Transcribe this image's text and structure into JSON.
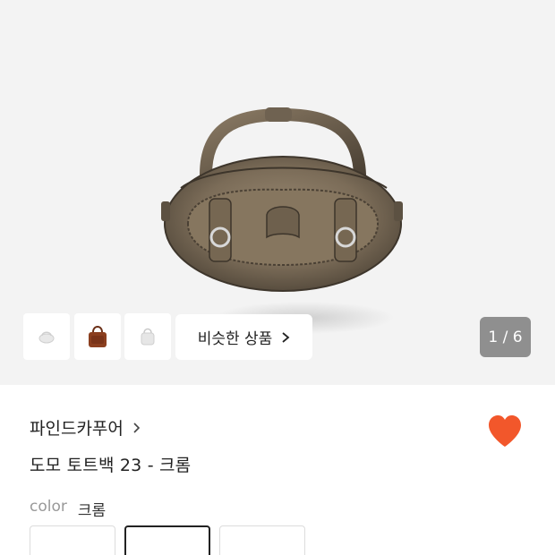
{
  "gallery": {
    "similar_label": "비슷한 상품",
    "counter": "1 / 6"
  },
  "product": {
    "brand": "파인드카푸어",
    "title": "도모 토트백 23 - 크롬",
    "color_label": "color",
    "color_value": "크롬"
  },
  "colors": {
    "heart": "#f2572b",
    "counter_bg": "#8f8f8f"
  },
  "icons": {
    "brand_arrow": "chevron-right-icon",
    "similar_arrow": "chevron-right-icon",
    "wishlist": "heart-icon"
  }
}
